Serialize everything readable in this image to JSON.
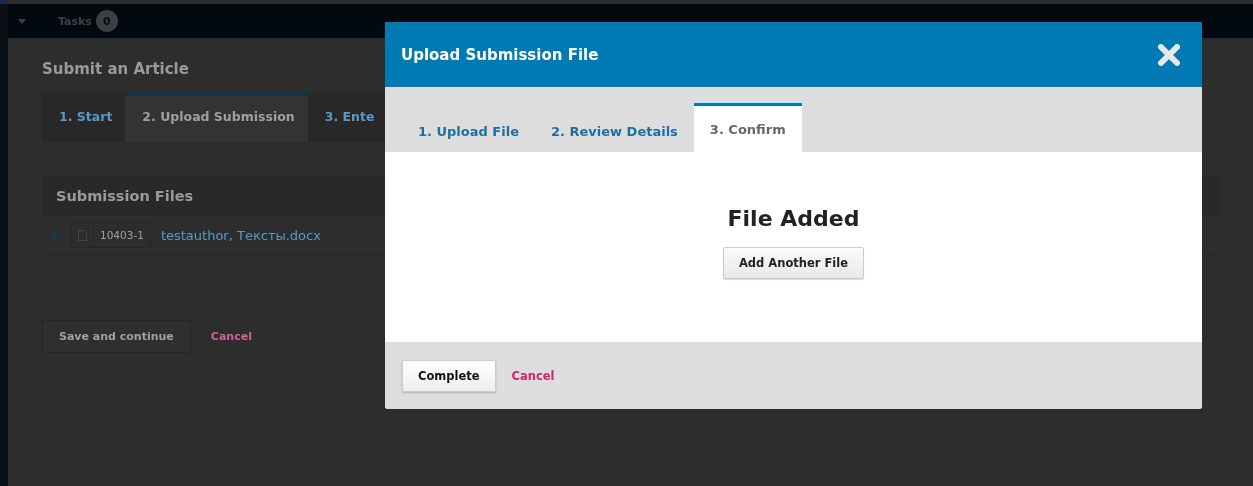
{
  "top_bar": {
    "tasks_label": "Tasks",
    "tasks_count": "0"
  },
  "page": {
    "title": "Submit an Article",
    "tabs": [
      {
        "label": "1. Start",
        "selected": false
      },
      {
        "label": "2. Upload Submission",
        "selected": true
      },
      {
        "label": "3. Ente",
        "selected": false
      }
    ],
    "files_panel": {
      "title": "Submission Files",
      "rows": [
        {
          "id": "10403-1",
          "name": "testauthor, Тексты.docx"
        }
      ]
    },
    "save_button": "Save and continue",
    "cancel_link": "Cancel"
  },
  "modal": {
    "title": "Upload Submission File",
    "tabs": [
      {
        "label": "1. Upload File",
        "selected": false
      },
      {
        "label": "2. Review Details",
        "selected": false
      },
      {
        "label": "3. Confirm",
        "selected": true
      }
    ],
    "heading": "File Added",
    "add_button": "Add Another File",
    "complete_button": "Complete",
    "cancel_link": "Cancel"
  }
}
